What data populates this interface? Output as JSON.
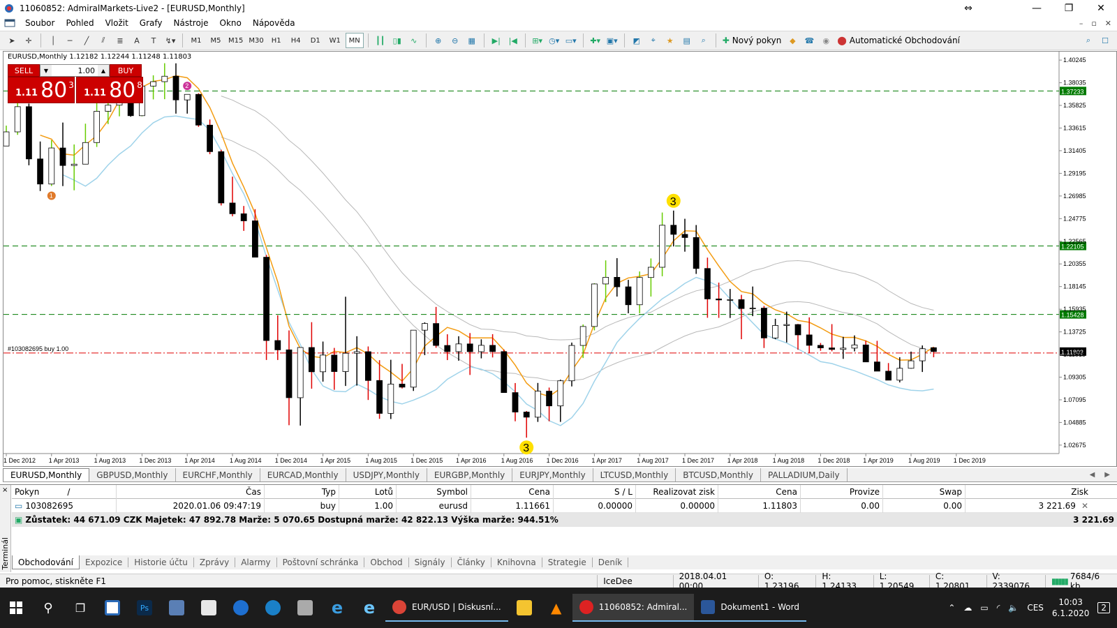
{
  "window": {
    "title": "11060852: AdmiralMarkets-Live2 - [EURUSD,Monthly]",
    "minimize": "—",
    "maximize": "❐",
    "close": "✕"
  },
  "menu": {
    "items": [
      "Soubor",
      "Pohled",
      "Vložit",
      "Grafy",
      "Nástroje",
      "Okno",
      "Nápověda"
    ],
    "restore_icons": [
      "–",
      "▫",
      "✕"
    ]
  },
  "toolbar": {
    "timeframes": [
      "M1",
      "M5",
      "M15",
      "M30",
      "H1",
      "H4",
      "D1",
      "W1",
      "MN"
    ],
    "active_timeframe": "MN",
    "new_order_label": "Nový pokyn",
    "auto_trading_label": "Automatické Obchodování"
  },
  "chart": {
    "symbol_line": "EURUSD,Monthly  1.12182 1.12244 1.11248 1.11803",
    "order_line_label": "#103082695 buy 1.00",
    "one_click": {
      "sell_label": "SELL",
      "buy_label": "BUY",
      "lot": "1.00",
      "sell_small": "1.11",
      "sell_big": "80",
      "sell_sup": "3",
      "buy_small": "1.11",
      "buy_big": "80",
      "buy_sup": "8"
    },
    "colors": {
      "bull_candle": "#ffffff",
      "bear_candle": "#000000",
      "bull_wick_green": "#66cc00",
      "bear_wick_red": "#e00000",
      "orange_ma": "#f39c12",
      "lightblue_ma": "#9fd3ea",
      "grey_ma": "#b8b8b8",
      "level_line": "#007a00",
      "order_line": "#e00000",
      "current_price_bg": "#000000"
    }
  },
  "chart_data": {
    "type": "candlestick",
    "symbol": "EURUSD",
    "timeframe": "Monthly",
    "ohlc_last": {
      "open": 1.12182,
      "high": 1.12244,
      "low": 1.11248,
      "close": 1.11803
    },
    "x_ticks": [
      "1 Dec 2012",
      "1 Apr 2013",
      "1 Aug 2013",
      "1 Dec 2013",
      "1 Apr 2014",
      "1 Aug 2014",
      "1 Dec 2014",
      "1 Apr 2015",
      "1 Aug 2015",
      "1 Dec 2015",
      "1 Apr 2016",
      "1 Aug 2016",
      "1 Dec 2016",
      "1 Apr 2017",
      "1 Aug 2017",
      "1 Dec 2017",
      "1 Apr 2018",
      "1 Aug 2018",
      "1 Dec 2018",
      "1 Apr 2019",
      "1 Aug 2019",
      "1 Dec 2019"
    ],
    "y_ticks": [
      "1.40245",
      "1.38035",
      "1.35825",
      "1.33615",
      "1.31405",
      "1.29195",
      "1.26985",
      "1.24775",
      "1.22565",
      "1.20355",
      "1.18145",
      "1.15935",
      "1.13725",
      "1.11515",
      "1.09305",
      "1.07095",
      "1.04885",
      "1.02675"
    ],
    "ylim": [
      1.0185,
      1.4107
    ],
    "horizontal_levels": [
      {
        "value": 1.37233,
        "label": "1.37233"
      },
      {
        "value": 1.22105,
        "label": "1.22105"
      },
      {
        "value": 1.15428,
        "label": "1.15428"
      }
    ],
    "order_price": 1.11661,
    "current_price": {
      "value": 1.11803,
      "label": "1.11803"
    },
    "candles": [
      [
        1.3186,
        1.3385,
        1.3258,
        1.3324
      ],
      [
        1.3324,
        1.3711,
        1.3295,
        1.357
      ],
      [
        1.357,
        1.36,
        1.2998,
        1.306
      ],
      [
        1.306,
        1.323,
        1.2747,
        1.2815
      ],
      [
        1.2815,
        1.3243,
        1.2796,
        1.3167
      ],
      [
        1.3167,
        1.3415,
        1.2795,
        1.2996
      ],
      [
        1.2996,
        1.3201,
        1.2754,
        1.3009
      ],
      [
        1.3009,
        1.3404,
        1.3007,
        1.322
      ],
      [
        1.322,
        1.3833,
        1.3177,
        1.3525
      ],
      [
        1.3525,
        1.3705,
        1.34,
        1.3585
      ],
      [
        1.3585,
        1.3832,
        1.3476,
        1.38
      ],
      [
        1.38,
        1.3893,
        1.3472,
        1.3482
      ],
      [
        1.3482,
        1.3737,
        1.3476,
        1.3771
      ],
      [
        1.3771,
        1.3876,
        1.3641,
        1.3814
      ],
      [
        1.3814,
        1.3994,
        1.3643,
        1.3867
      ],
      [
        1.3867,
        1.3993,
        1.3502,
        1.3636
      ],
      [
        1.3636,
        1.3677,
        1.3502,
        1.369
      ],
      [
        1.369,
        1.3701,
        1.3373,
        1.339
      ],
      [
        1.339,
        1.3445,
        1.3106,
        1.3131
      ],
      [
        1.3131,
        1.315,
        1.2606,
        1.263
      ],
      [
        1.263,
        1.2887,
        1.25,
        1.2525
      ],
      [
        1.2525,
        1.2601,
        1.2358,
        1.2456
      ],
      [
        1.2456,
        1.257,
        1.21,
        1.2101
      ],
      [
        1.2101,
        1.2124,
        1.1098,
        1.1288
      ],
      [
        1.1288,
        1.1534,
        1.1098,
        1.1197
      ],
      [
        1.1197,
        1.1387,
        1.0462,
        1.073
      ],
      [
        1.073,
        1.1052,
        1.0458,
        1.122
      ],
      [
        1.122,
        1.1467,
        1.0818,
        1.0983
      ],
      [
        1.0983,
        1.1278,
        1.0887,
        1.1146
      ],
      [
        1.1146,
        1.1216,
        1.0807,
        1.0985
      ],
      [
        1.0985,
        1.1715,
        1.0845,
        1.1164
      ],
      [
        1.1164,
        1.133,
        1.0848,
        1.1179
      ],
      [
        1.1179,
        1.123,
        1.0708,
        1.0898
      ],
      [
        1.0898,
        1.1096,
        1.0524,
        1.0577
      ],
      [
        1.0577,
        1.11,
        1.0522,
        1.0863
      ],
      [
        1.0863,
        1.106,
        1.082,
        1.0833
      ],
      [
        1.0833,
        1.1375,
        1.0796,
        1.1389
      ],
      [
        1.1389,
        1.1465,
        1.1145,
        1.1454
      ],
      [
        1.1454,
        1.1616,
        1.1217,
        1.124
      ],
      [
        1.124,
        1.1349,
        1.1097,
        1.118
      ],
      [
        1.118,
        1.133,
        1.1091,
        1.1255
      ],
      [
        1.1255,
        1.1361,
        1.0952,
        1.1179
      ],
      [
        1.1179,
        1.13,
        1.1114,
        1.1241
      ],
      [
        1.1241,
        1.135,
        1.1123,
        1.118
      ],
      [
        1.118,
        1.12,
        1.1,
        1.078
      ],
      [
        1.078,
        1.0873,
        1.05,
        1.059
      ],
      [
        1.059,
        1.06,
        1.034,
        1.054
      ],
      [
        1.054,
        1.0874,
        1.0494,
        1.0794
      ],
      [
        1.0794,
        1.0829,
        1.05,
        1.065
      ],
      [
        1.065,
        1.0906,
        1.0494,
        1.0895
      ],
      [
        1.0895,
        1.1268,
        1.084,
        1.124
      ],
      [
        1.124,
        1.1445,
        1.1117,
        1.1425
      ],
      [
        1.1425,
        1.1847,
        1.1387,
        1.184
      ],
      [
        1.184,
        1.207,
        1.1662,
        1.1905
      ],
      [
        1.1905,
        1.2092,
        1.1717,
        1.1812
      ],
      [
        1.1812,
        1.188,
        1.1554,
        1.1637
      ],
      [
        1.1637,
        1.1962,
        1.1554,
        1.1903
      ],
      [
        1.1903,
        1.2089,
        1.1717,
        1.2003
      ],
      [
        1.2003,
        1.2537,
        1.1915,
        1.2413
      ],
      [
        1.2413,
        1.2556,
        1.2206,
        1.2324
      ],
      [
        1.2324,
        1.2476,
        1.2155,
        1.2293
      ],
      [
        1.2293,
        1.2415,
        1.1938,
        1.1991
      ],
      [
        1.1991,
        1.2097,
        1.151,
        1.1694
      ],
      [
        1.1694,
        1.1853,
        1.1509,
        1.1684
      ],
      [
        1.1684,
        1.1791,
        1.1508,
        1.1687
      ],
      [
        1.1687,
        1.1734,
        1.1301,
        1.16
      ],
      [
        1.16,
        1.1815,
        1.1526,
        1.1604
      ],
      [
        1.1604,
        1.1625,
        1.1215,
        1.1313
      ],
      [
        1.1313,
        1.15,
        1.1301,
        1.1435
      ],
      [
        1.1435,
        1.157,
        1.1269,
        1.1444
      ],
      [
        1.1444,
        1.145,
        1.1198,
        1.1343
      ],
      [
        1.1343,
        1.1514,
        1.1169,
        1.1241
      ],
      [
        1.1241,
        1.1264,
        1.1188,
        1.1216
      ],
      [
        1.1216,
        1.1448,
        1.1183,
        1.1201
      ],
      [
        1.1201,
        1.1324,
        1.1109,
        1.1214
      ],
      [
        1.1214,
        1.1338,
        1.1182,
        1.1245
      ],
      [
        1.1245,
        1.1286,
        1.1109,
        1.1079
      ],
      [
        1.1079,
        1.1285,
        1.0999,
        1.0989
      ],
      [
        1.0989,
        1.1068,
        1.0926,
        1.0901
      ],
      [
        1.0901,
        1.1125,
        1.0879,
        1.1017
      ],
      [
        1.1017,
        1.118,
        1.1013,
        1.109
      ],
      [
        1.109,
        1.124,
        1.0981,
        1.1208
      ],
      [
        1.12182,
        1.12244,
        1.11248,
        1.11803
      ]
    ],
    "markers": [
      {
        "label": "1",
        "color": "#e07a2a"
      },
      {
        "label": "2",
        "color": "#cc3399"
      },
      {
        "label": "3",
        "color": "#ffe000"
      },
      {
        "label": "3",
        "color": "#ffe000"
      }
    ]
  },
  "symbol_tabs": [
    "EURUSD,Monthly",
    "GBPUSD,Monthly",
    "EURCHF,Monthly",
    "EURCAD,Monthly",
    "USDJPY,Monthly",
    "EURGBP,Monthly",
    "EURJPY,Monthly",
    "LTCUSD,Monthly",
    "BTCUSD,Monthly",
    "PALLADIUM,Daily"
  ],
  "terminal": {
    "side_label": "Terminál",
    "close_x": "×",
    "columns": [
      "Pokyn",
      "Čas",
      "Typ",
      "Lotů",
      "Symbol",
      "Cena",
      "S / L",
      "Realizovat zisk",
      "Cena",
      "Provize",
      "Swap",
      "Zisk"
    ],
    "sort_marker": "/",
    "rows": [
      [
        "103082695",
        "2020.01.06 09:47:19",
        "buy",
        "1.00",
        "eurusd",
        "1.11661",
        "0.00000",
        "0.00000",
        "1.11803",
        "0.00",
        "0.00",
        "3 221.69"
      ]
    ],
    "summary": "Zůstatek: 44 671.09 CZK  Majetek: 47 892.78  Marže: 5 070.65  Dostupná marže: 42 822.13  Výška marže: 944.51%",
    "summary_profit": "3 221.69",
    "tabs": [
      "Obchodování",
      "Expozice",
      "Historie účtu",
      "Zprávy",
      "Alarmy",
      "Poštovní schránka",
      "Obchod",
      "Signály",
      "Články",
      "Knihovna",
      "Strategie",
      "Deník"
    ],
    "active_tab": "Obchodování"
  },
  "status": {
    "help": "Pro pomoc, stiskněte F1",
    "profile": "IceDee",
    "datetime": "2018.04.01 00:00",
    "open": "O: 1.23196",
    "high": "H: 1.24133",
    "low": "L: 1.20549",
    "close": "C: 1.20801",
    "volume": "V: 2339076",
    "traffic": "7684/6 kb"
  },
  "taskbar": {
    "apps": [
      {
        "label": "EUR/USD | Diskusní...",
        "color": "#db4437"
      },
      {
        "label": "11060852: Admiral...",
        "color": "#d22"
      },
      {
        "label": "Dokument1 - Word",
        "color": "#2b579a"
      }
    ],
    "lang": "CES",
    "time": "10:03",
    "date": "6.1.2020",
    "notif_count": "2"
  }
}
